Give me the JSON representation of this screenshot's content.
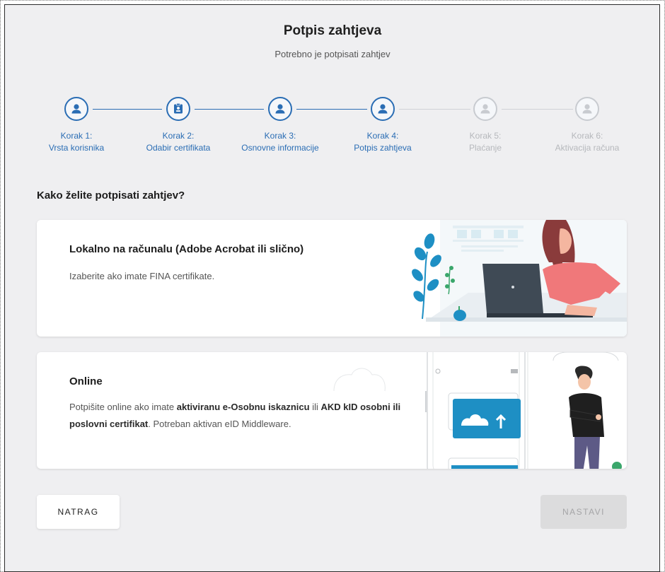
{
  "header": {
    "title": "Potpis zahtjeva",
    "subtitle": "Potrebno je potpisati zahtjev"
  },
  "stepper": {
    "steps": [
      {
        "label_top": "Korak 1:",
        "label_bottom": "Vrsta korisnika",
        "state": "done",
        "icon": "user-icon"
      },
      {
        "label_top": "Korak 2:",
        "label_bottom": "Odabir certifikata",
        "state": "done",
        "icon": "id-card-icon"
      },
      {
        "label_top": "Korak 3:",
        "label_bottom": "Osnovne informacije",
        "state": "done",
        "icon": "user-icon"
      },
      {
        "label_top": "Korak 4:",
        "label_bottom": "Potpis zahtjeva",
        "state": "active",
        "icon": "user-icon"
      },
      {
        "label_top": "Korak 5:",
        "label_bottom": "Plaćanje",
        "state": "inactive",
        "icon": "user-icon"
      },
      {
        "label_top": "Korak 6:",
        "label_bottom": "Aktivacija računa",
        "state": "inactive",
        "icon": "user-icon"
      }
    ]
  },
  "question": "Kako želite potpisati zahtjev?",
  "options": {
    "local": {
      "title": "Lokalno na računalu (Adobe Acrobat ili slično)",
      "desc": "Izaberite ako imate FINA certifikate."
    },
    "online": {
      "title": "Online",
      "desc_1": "Potpišite online ako imate ",
      "desc_bold_1": "aktiviranu e-Osobnu iskaznicu",
      "desc_2": " ili ",
      "desc_bold_2": "AKD kID osobni ili poslovni certifikat",
      "desc_3": ". Potreban aktivan eID Middleware."
    }
  },
  "buttons": {
    "back": "NATRAG",
    "next": "NASTAVI"
  },
  "colors": {
    "accent": "#2a6db4",
    "inactive": "#c8cbd0",
    "background": "#efeff1",
    "illustration_blue": "#1e8fc4",
    "illustration_pink": "#f0787a"
  }
}
